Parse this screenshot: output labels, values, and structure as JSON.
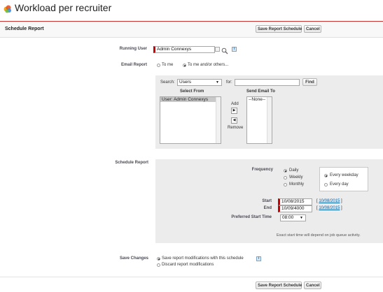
{
  "page": {
    "title": "Workload per recruiter"
  },
  "header": {
    "title": "Schedule Report",
    "save_label": "Save Report Schedule",
    "cancel_label": "Cancel"
  },
  "running_user": {
    "label": "Running User",
    "value": "Admin Connexys"
  },
  "email_report": {
    "label": "Email Report",
    "options": [
      "To me",
      "To me and/or others..."
    ],
    "selected": 1
  },
  "recipients": {
    "search_label": "Search:",
    "search_select": "Users",
    "for_label": "for:",
    "for_value": "",
    "find_label": "Find",
    "select_from_title": "Select From",
    "send_to_title": "Send Email To",
    "select_from_items": [
      "User: Admin Connexys"
    ],
    "send_to_items": [
      "--None--"
    ],
    "add_label": "Add",
    "remove_label": "Remove"
  },
  "schedule": {
    "label": "Schedule Report",
    "frequency_label": "Frequency",
    "frequency_options": [
      "Daily",
      "Weekly",
      "Monthly"
    ],
    "frequency_selected": 0,
    "day_options": [
      "Every weekday",
      "Every day"
    ],
    "day_selected": 0,
    "start_label": "Start",
    "start_value": "10/08/2015",
    "start_link": "10/08/2015",
    "end_label": "End",
    "end_value": "10/09/4000",
    "end_link": "10/08/2015",
    "time_label": "Preferred Start Time",
    "time_value": "08:00",
    "note": "Exact start time will depend on job queue activity."
  },
  "save_changes": {
    "label": "Save Changes",
    "options": [
      "Save report modifications with this schedule",
      "Discard report modifications"
    ],
    "selected": 0
  },
  "footer": {
    "save_label": "Save Report Schedule",
    "cancel_label": "Cancel"
  },
  "colors": {
    "required": "#cc0000",
    "link": "#015ba7",
    "panel": "#ececec"
  }
}
